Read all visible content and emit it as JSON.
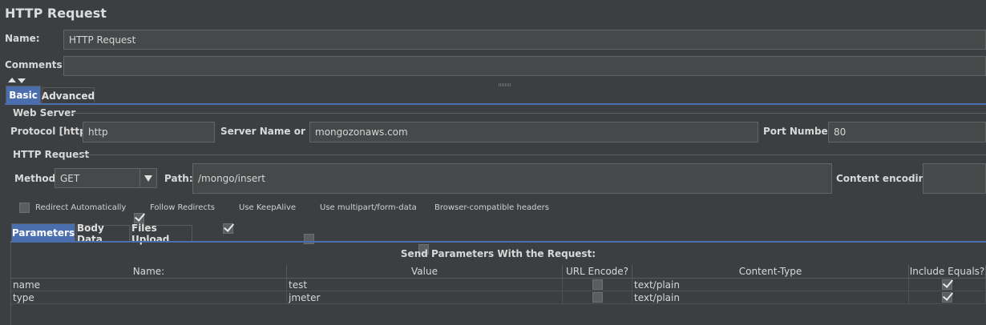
{
  "panel": {
    "title": "HTTP Request"
  },
  "form": {
    "name_label": "Name:",
    "name_value": "HTTP Request",
    "comments_label": "Comments:",
    "comments_value": ""
  },
  "tabs": [
    {
      "label": "Basic",
      "active": true
    },
    {
      "label": "Advanced",
      "active": false
    }
  ],
  "web_server": {
    "legend": "Web Server",
    "protocol_label": "Protocol [http]:",
    "protocol_value": "http",
    "server_label": "Server Name or IP:",
    "server_value": "mongozonaws.com",
    "port_label": "Port Number:",
    "port_value": "80"
  },
  "http_request": {
    "legend": "HTTP Request",
    "method_label": "Method:",
    "method_value": "GET",
    "path_label": "Path:",
    "path_value": "/mongo/insert",
    "encoding_label": "Content encoding:",
    "encoding_value": ""
  },
  "options": [
    {
      "label": "Redirect Automatically",
      "checked": false
    },
    {
      "label": "Follow Redirects",
      "checked": true
    },
    {
      "label": "Use KeepAlive",
      "checked": true
    },
    {
      "label": "Use multipart/form-data",
      "checked": false
    },
    {
      "label": "Browser-compatible headers",
      "checked": false
    }
  ],
  "sub_tabs": [
    {
      "label": "Parameters",
      "active": true
    },
    {
      "label": "Body Data",
      "active": false
    },
    {
      "label": "Files Upload",
      "active": false
    }
  ],
  "params_table": {
    "caption": "Send Parameters With the Request:",
    "columns": [
      "Name:",
      "Value",
      "URL Encode?",
      "Content-Type",
      "Include Equals?"
    ],
    "rows": [
      {
        "name": "name",
        "value": "test",
        "url_encode": false,
        "content_type": "text/plain",
        "include_equals": true
      },
      {
        "name": "type",
        "value": "jmeter",
        "url_encode": false,
        "content_type": "text/plain",
        "include_equals": true
      }
    ]
  },
  "colors": {
    "background": "#3c3f41",
    "field": "#45494a",
    "active_tab": "#4b6eaf"
  },
  "icons": {
    "collapse": "collapse-arrows-icon",
    "dropdown": "chevron-down-icon",
    "splitter": "splitter-grip-icon"
  }
}
